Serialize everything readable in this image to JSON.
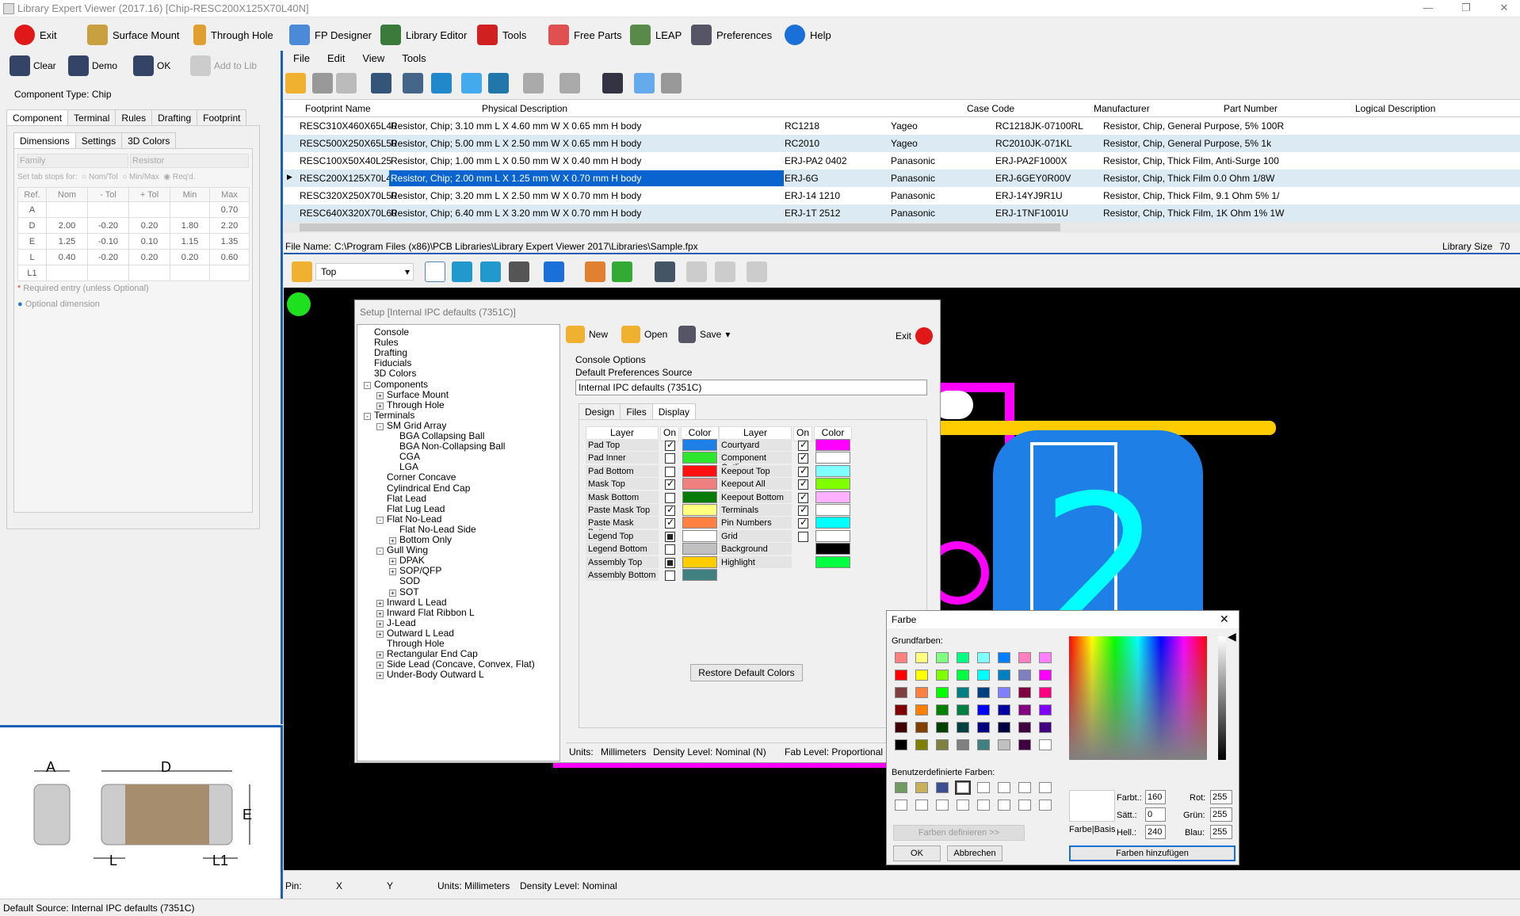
{
  "window": {
    "title": "Library Expert Viewer (2017.16) [Chip-RESC200X125X70L40N]"
  },
  "topbar": {
    "exit": "Exit",
    "surface_mount": "Surface Mount",
    "through_hole": "Through Hole",
    "fp_designer": "FP Designer",
    "library_editor": "Library Editor",
    "tools": "Tools",
    "free_parts": "Free Parts",
    "leap": "LEAP",
    "preferences": "Preferences",
    "help": "Help"
  },
  "left": {
    "clear": "Clear",
    "demo": "Demo",
    "ok": "OK",
    "add_to_lib": "Add to Lib",
    "component_type": "Component Type: Chip",
    "tabs": [
      "Component",
      "Terminal",
      "Rules",
      "Drafting",
      "Footprint"
    ],
    "subtabs": [
      "Dimensions",
      "Settings",
      "3D Colors"
    ],
    "family_label": "Family",
    "family_value": "Resistor",
    "tabstops_label": "Set tab stops for:",
    "tabstops": [
      "Nom/Tol",
      "Min/Max",
      "Req'd."
    ],
    "dim_headers": [
      "Ref.",
      "Nom",
      "- Tol",
      "+ Tol",
      "Min",
      "Max"
    ],
    "dims": [
      [
        "A",
        "",
        "",
        "",
        "",
        "0.70"
      ],
      [
        "D",
        "2.00",
        "-0.20",
        "0.20",
        "1.80",
        "2.20"
      ],
      [
        "E",
        "1.25",
        "-0.10",
        "0.10",
        "1.15",
        "1.35"
      ],
      [
        "L",
        "0.40",
        "-0.20",
        "0.20",
        "0.20",
        "0.60"
      ],
      [
        "L1",
        "",
        "",
        "",
        "",
        ""
      ]
    ],
    "required_note": "Required entry (unless Optional)",
    "optional_note": "Optional dimension",
    "diagram_labels": {
      "a": "A",
      "d": "D",
      "e": "E",
      "l": "L",
      "l1": "L1"
    }
  },
  "menu": [
    "File",
    "Edit",
    "View",
    "Tools"
  ],
  "table": {
    "headers": [
      "Footprint Name",
      "Physical Description",
      "Case Code",
      "Manufacturer",
      "Part Number",
      "Logical Description"
    ],
    "rows": [
      [
        "RESC310X460X65L40",
        "Resistor, Chip; 3.10 mm L X 4.60 mm W X 0.65 mm H body",
        "RC1218",
        "Yageo",
        "RC1218JK-07100RL",
        "Resistor, Chip, General Purpose, 5% 100R"
      ],
      [
        "RESC500X250X65L50",
        "Resistor, Chip; 5.00 mm L X 2.50 mm W X 0.65 mm H body",
        "RC2010",
        "Yageo",
        "RC2010JK-071KL",
        "Resistor, Chip, General Purpose, 5% 1k"
      ],
      [
        "RESC100X50X40L25",
        "Resistor, Chip; 1.00 mm L X 0.50 mm W X 0.40 mm H body",
        "ERJ-PA2 0402",
        "Panasonic",
        "ERJ-PA2F1000X",
        "Resistor, Chip, Thick Film, Anti-Surge 100"
      ],
      [
        "RESC200X125X70L40",
        "Resistor, Chip; 2.00 mm L X 1.25 mm W X 0.70 mm H body",
        "ERJ-6G",
        "Panasonic",
        "ERJ-6GEY0R00V",
        "Resistor, Chip, Thick Film 0.0 Ohm 1/8W"
      ],
      [
        "RESC320X250X70L50",
        "Resistor, Chip; 3.20 mm L X 2.50 mm W X 0.70 mm H body",
        "ERJ-14 1210",
        "Panasonic",
        "ERJ-14YJ9R1U",
        "Resistor, Chip, Thick Film, 9.1 Ohm 5% 1/"
      ],
      [
        "RESC640X320X70L60",
        "Resistor, Chip; 6.40 mm L X 3.20 mm W X 0.70 mm H body",
        "ERJ-1T 2512",
        "Panasonic",
        "ERJ-1TNF1001U",
        "Resistor, Chip, Thick Film, 1K Ohm 1% 1W"
      ]
    ],
    "selected_index": 3
  },
  "fileinfo": {
    "label": "File Name:",
    "path": "C:\\Program Files (x86)\\PCB Libraries\\Library Expert Viewer 2017\\Libraries\\Sample.fpx",
    "size_label": "Library Size",
    "size_value": "70"
  },
  "layer_select": "Top",
  "setup": {
    "title": "Setup [Internal IPC defaults (7351C)]",
    "tree": [
      {
        "t": "Console",
        "d": 0
      },
      {
        "t": "Rules",
        "d": 0
      },
      {
        "t": "Drafting",
        "d": 0
      },
      {
        "t": "Fiducials",
        "d": 0
      },
      {
        "t": "3D Colors",
        "d": 0
      },
      {
        "t": "Components",
        "d": 0,
        "pm": "-"
      },
      {
        "t": "Surface Mount",
        "d": 1,
        "pm": "+"
      },
      {
        "t": "Through Hole",
        "d": 1,
        "pm": "+"
      },
      {
        "t": "Terminals",
        "d": 0,
        "pm": "-"
      },
      {
        "t": "SM Grid Array",
        "d": 1,
        "pm": "-"
      },
      {
        "t": "BGA Collapsing Ball",
        "d": 2
      },
      {
        "t": "BGA Non-Collapsing Ball",
        "d": 2
      },
      {
        "t": "CGA",
        "d": 2
      },
      {
        "t": "LGA",
        "d": 2
      },
      {
        "t": "Corner Concave",
        "d": 1
      },
      {
        "t": "Cylindrical End Cap",
        "d": 1
      },
      {
        "t": "Flat Lead",
        "d": 1
      },
      {
        "t": "Flat Lug Lead",
        "d": 1
      },
      {
        "t": "Flat No-Lead",
        "d": 1,
        "pm": "-"
      },
      {
        "t": "Flat No-Lead Side",
        "d": 2
      },
      {
        "t": "Bottom Only",
        "d": 2,
        "pm": "+"
      },
      {
        "t": "Gull Wing",
        "d": 1,
        "pm": "-"
      },
      {
        "t": "DPAK",
        "d": 2,
        "pm": "+"
      },
      {
        "t": "SOP/QFP",
        "d": 2,
        "pm": "+"
      },
      {
        "t": "SOD",
        "d": 2
      },
      {
        "t": "SOT",
        "d": 2,
        "pm": "+"
      },
      {
        "t": "Inward L Lead",
        "d": 1,
        "pm": "+"
      },
      {
        "t": "Inward Flat Ribbon L",
        "d": 1,
        "pm": "+"
      },
      {
        "t": "J-Lead",
        "d": 1,
        "pm": "+"
      },
      {
        "t": "Outward L Lead",
        "d": 1,
        "pm": "+"
      },
      {
        "t": "Through Hole",
        "d": 1
      },
      {
        "t": "Rectangular End Cap",
        "d": 1,
        "pm": "+"
      },
      {
        "t": "Side Lead (Concave, Convex, Flat)",
        "d": 1,
        "pm": "+"
      },
      {
        "t": "Under-Body Outward L",
        "d": 1,
        "pm": "+"
      }
    ],
    "new": "New",
    "open": "Open",
    "save": "Save",
    "exit": "Exit",
    "console_options": "Console Options",
    "default_pref": "Default Preferences Source",
    "pref_value": "Internal IPC defaults (7351C)",
    "inner_tabs": [
      "Design",
      "Files",
      "Display"
    ],
    "col_layer": "Layer",
    "col_on": "On",
    "col_color": "Color",
    "layers_left": [
      {
        "n": "Pad Top",
        "on": "on",
        "c": "#1e7fe6"
      },
      {
        "n": "Pad Inner",
        "on": "off",
        "c": "#2ee62e"
      },
      {
        "n": "Pad Bottom",
        "on": "off",
        "c": "#ff1010"
      },
      {
        "n": "Mask Top",
        "on": "on",
        "c": "#f08080"
      },
      {
        "n": "Mask Bottom",
        "on": "off",
        "c": "#087a08"
      },
      {
        "n": "Paste Mask Top",
        "on": "on",
        "c": "#ffff80"
      },
      {
        "n": "Paste Mask Bottom",
        "on": "on",
        "c": "#ff8040"
      },
      {
        "n": "Legend Top",
        "on": "part",
        "c": "#ffffff"
      },
      {
        "n": "Legend Bottom",
        "on": "off",
        "c": "#c0c0c0"
      },
      {
        "n": "Assembly Top",
        "on": "part",
        "c": "#ffcc00"
      },
      {
        "n": "Assembly Bottom",
        "on": "off",
        "c": "#408080"
      }
    ],
    "layers_right": [
      {
        "n": "Courtyard",
        "on": "on",
        "c": "#ff00ff"
      },
      {
        "n": "Component Outline",
        "on": "on",
        "c": "#ffffff"
      },
      {
        "n": "Keepout Top",
        "on": "on",
        "c": "#80ffff"
      },
      {
        "n": "Keepout All",
        "on": "on",
        "c": "#80ff00"
      },
      {
        "n": "Keepout Bottom",
        "on": "on",
        "c": "#ffb0ff"
      },
      {
        "n": "Terminals",
        "on": "on",
        "c": "#ffffff"
      },
      {
        "n": "Pin Numbers",
        "on": "on",
        "c": "#00ffff"
      },
      {
        "n": "Grid",
        "on": "off",
        "c": "#ffffff"
      },
      {
        "n": "Background",
        "on": "none",
        "c": "#000000"
      },
      {
        "n": "Highlight",
        "on": "none",
        "c": "#00ff40"
      }
    ],
    "restore": "Restore Default Colors",
    "status": [
      "Units:",
      "Millimeters",
      "Density Level: Nominal (N)",
      "Fab Level: Proportional"
    ]
  },
  "farbe": {
    "title": "Farbe",
    "basic": "Grundfarben:",
    "custom": "Benutzerdefinierte Farben:",
    "define": "Farben definieren >>",
    "ok": "OK",
    "cancel": "Abbrechen",
    "add": "Farben hinzufügen",
    "farbbasis": "Farbe|Basis",
    "farbt_label": "Farbt.:",
    "farbt": "160",
    "satt_label": "Sätt.:",
    "satt": "0",
    "hell_label": "Hell.:",
    "hell": "240",
    "rot_label": "Rot:",
    "rot": "255",
    "gruen_label": "Grün:",
    "gruen": "255",
    "blau_label": "Blau:",
    "blau": "255",
    "basic_colors": [
      "#ff8080",
      "#ffff80",
      "#80ff80",
      "#00ff80",
      "#80ffff",
      "#0080ff",
      "#ff80c0",
      "#ff80ff",
      "#ff0000",
      "#ffff00",
      "#80ff00",
      "#00ff40",
      "#00ffff",
      "#0080c0",
      "#8080c0",
      "#ff00ff",
      "#804040",
      "#ff8040",
      "#00ff00",
      "#008080",
      "#004080",
      "#8080ff",
      "#800040",
      "#ff0080",
      "#800000",
      "#ff8000",
      "#008000",
      "#008040",
      "#0000ff",
      "#0000a0",
      "#800080",
      "#8000ff",
      "#400000",
      "#804000",
      "#004000",
      "#004040",
      "#000080",
      "#000040",
      "#400040",
      "#400080",
      "#000000",
      "#808000",
      "#808040",
      "#808080",
      "#408080",
      "#c0c0c0",
      "#400040",
      "#ffffff"
    ],
    "custom_colors": [
      "#6f9a62",
      "#c9b15c",
      "#3c4f93",
      "#ffffff",
      "#ffffff",
      "#ffffff",
      "#ffffff",
      "#ffffff",
      "#ffffff",
      "#ffffff",
      "#ffffff",
      "#ffffff",
      "#ffffff",
      "#ffffff",
      "#ffffff",
      "#ffffff"
    ]
  },
  "status": {
    "pin": "Pin:",
    "x": "X",
    "y": "Y",
    "units": "Units: Millimeters",
    "density": "Density Level: Nominal"
  },
  "bottom": {
    "default_source": "Default Source:   Internal IPC defaults (7351C)"
  },
  "canvas": {
    "pin_number": "2"
  }
}
